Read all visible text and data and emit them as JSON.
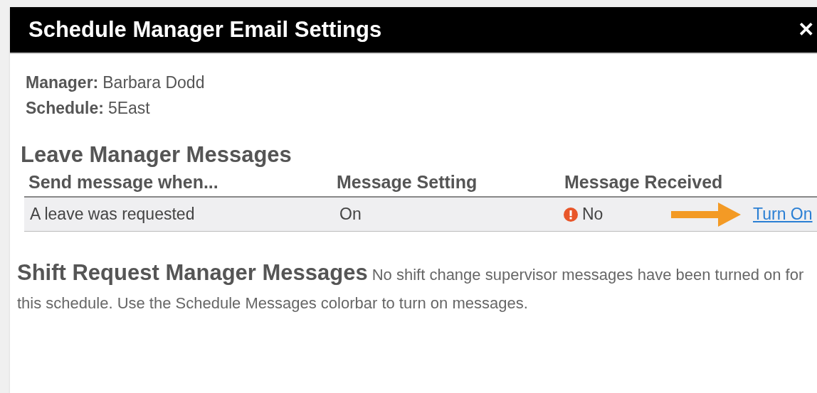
{
  "dialog": {
    "title": "Schedule Manager Email Settings",
    "close": "✕"
  },
  "info": [
    {
      "label": "Manager:",
      "value": "Barbara Dodd"
    },
    {
      "label": "Schedule:",
      "value": "5East"
    }
  ],
  "leave_section": {
    "title": "Leave Manager Messages",
    "table": {
      "columns": [
        "Send message when...",
        "Message Setting",
        "Message Received"
      ],
      "rows": [
        {
          "event": "A leave was requested",
          "setting": "On",
          "received": "No",
          "action": "Turn On"
        }
      ]
    }
  },
  "shift_section": {
    "title": "Shift Request Manager Messages",
    "text": "No shift change supervisor messages have been turned on for this schedule. Use the Schedule Messages colorbar to turn on messages."
  }
}
